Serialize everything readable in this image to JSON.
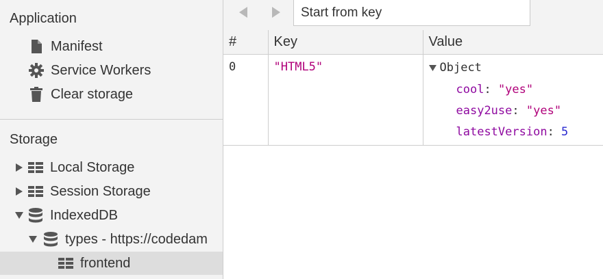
{
  "sidebar": {
    "application_header": "Application",
    "application_items": [
      {
        "label": "Manifest",
        "icon": "document-icon"
      },
      {
        "label": "Service Workers",
        "icon": "gear-icon"
      },
      {
        "label": "Clear storage",
        "icon": "trash-icon"
      }
    ],
    "storage_header": "Storage",
    "storage_items": [
      {
        "label": "Local Storage",
        "icon": "grid-icon",
        "expanded": false
      },
      {
        "label": "Session Storage",
        "icon": "grid-icon",
        "expanded": false
      },
      {
        "label": "IndexedDB",
        "icon": "database-icon",
        "expanded": true
      },
      {
        "label": "types - https://codedam",
        "icon": "database-icon",
        "expanded": true
      },
      {
        "label": "frontend",
        "icon": "grid-icon",
        "selected": true
      }
    ]
  },
  "toolbar": {
    "key_placeholder": "Start from key"
  },
  "table": {
    "columns": [
      "#",
      "Key",
      "Value"
    ],
    "rows": [
      {
        "index": "0",
        "key": "\"HTML5\"",
        "value_type": "Object",
        "properties": [
          {
            "name": "cool",
            "value": "\"yes\""
          },
          {
            "name": "easy2use",
            "value": "\"yes\""
          },
          {
            "name": "latestVersion",
            "value": "5"
          }
        ]
      }
    ]
  },
  "colors": {
    "string": "#b0007a",
    "property": "#8f0aa0",
    "number": "#2a2ad0",
    "selected_row": "#dddddd"
  }
}
